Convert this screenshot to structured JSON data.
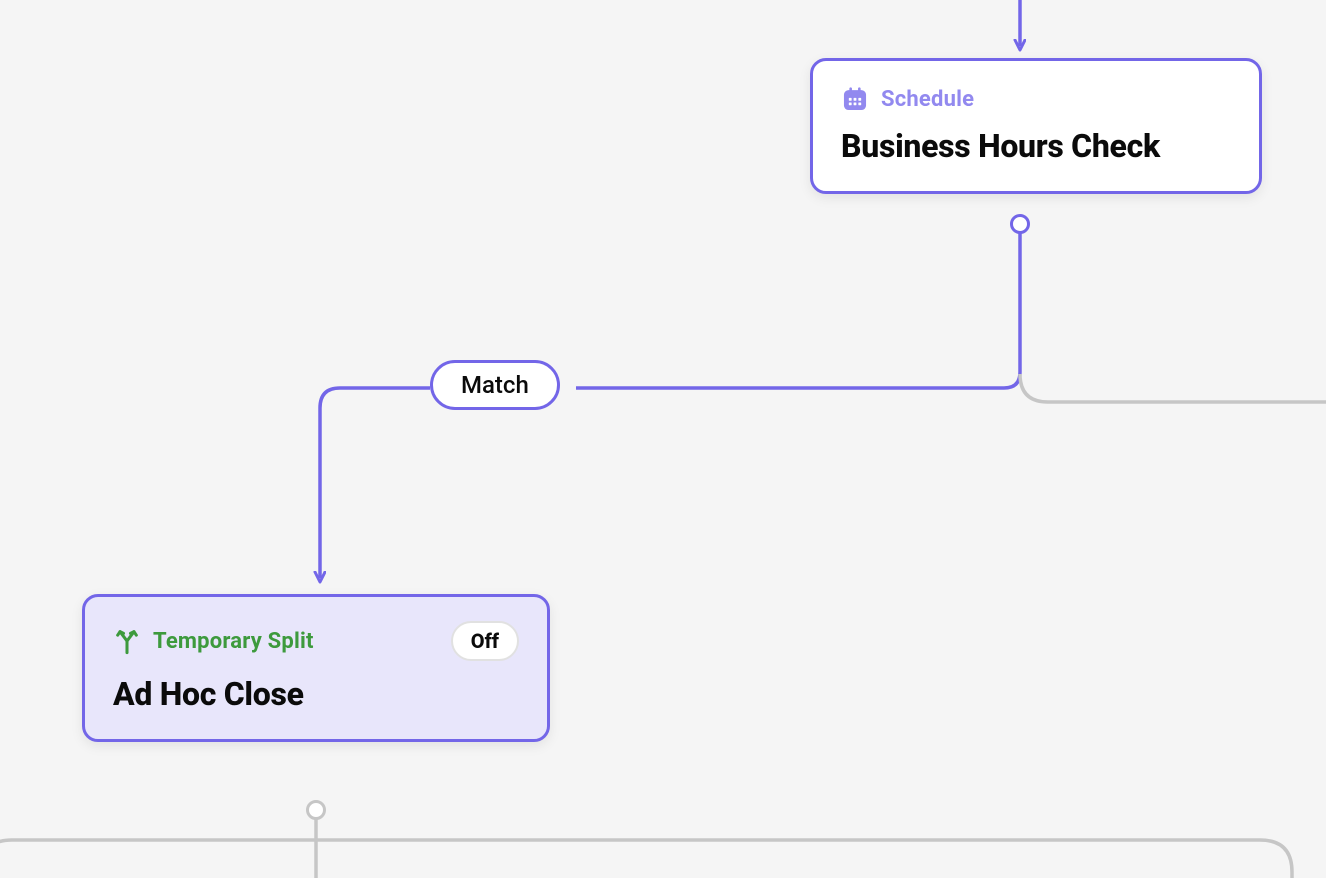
{
  "nodes": {
    "business_hours": {
      "type_label": "Schedule",
      "title": "Business Hours Check"
    },
    "ad_hoc_close": {
      "type_label": "Temporary Split",
      "title": "Ad Hoc Close",
      "badge": "Off"
    }
  },
  "edges": {
    "match": {
      "label": "Match"
    }
  },
  "colors": {
    "purple": "#7366e8",
    "green": "#3d9a3d",
    "gray": "#c6c6c6"
  }
}
